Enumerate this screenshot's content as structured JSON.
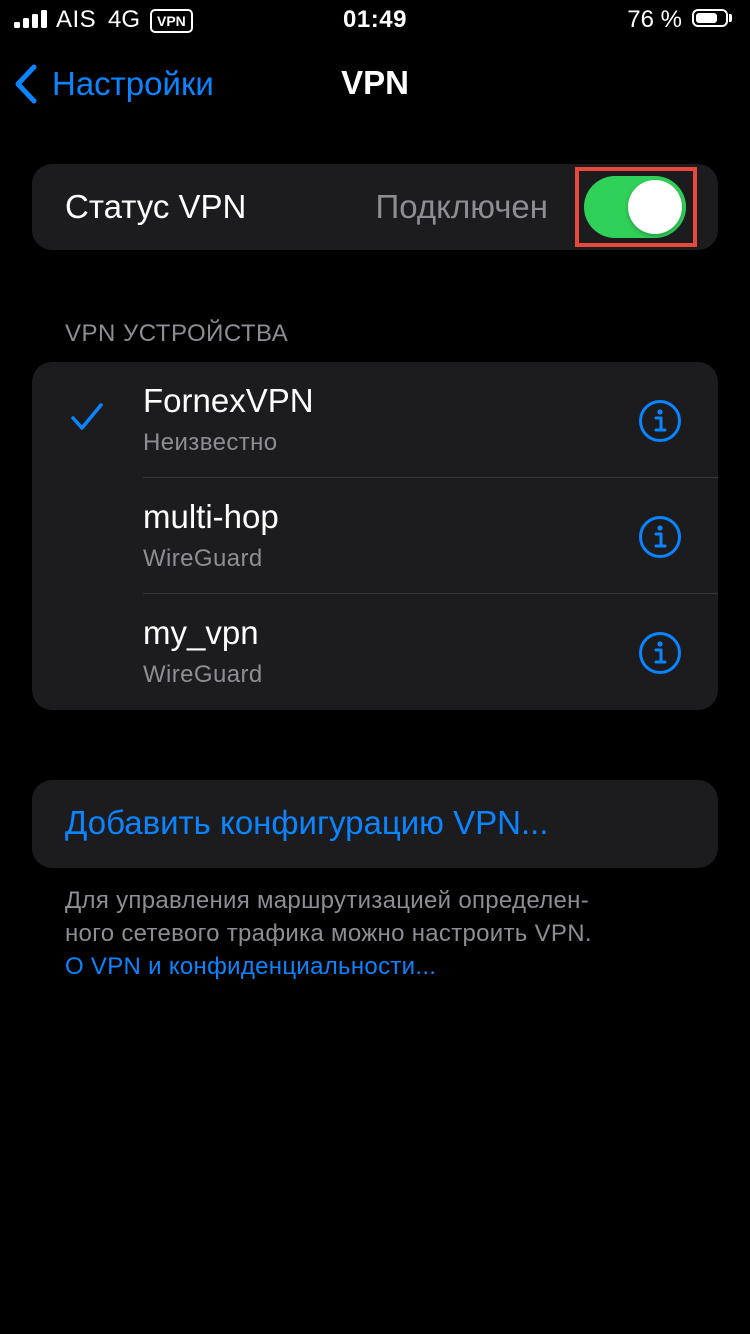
{
  "status_bar": {
    "carrier": "AIS",
    "network": "4G",
    "vpn_badge": "VPN",
    "time": "01:49",
    "battery_percent_label": "76 %",
    "battery_level": 0.76
  },
  "nav": {
    "back_label": "Настройки",
    "title": "VPN"
  },
  "vpn_status": {
    "label": "Статус VPN",
    "value": "Подключен",
    "toggle_on": true,
    "toggle_color": "#30d158"
  },
  "devices": {
    "header": "VPN УСТРОЙСТВА",
    "items": [
      {
        "name": "FornexVPN",
        "type": "Неизвестно",
        "selected": true
      },
      {
        "name": "multi-hop",
        "type": "WireGuard",
        "selected": false
      },
      {
        "name": "my_vpn",
        "type": "WireGuard",
        "selected": false
      }
    ]
  },
  "add_config": {
    "label": "Добавить конфигурацию VPN..."
  },
  "footer": {
    "line1": "Для управления маршрутизацией определен-",
    "line2": "ного сетевого трафика можно настроить VPN.",
    "link": "О VPN и конфиденциальности..."
  },
  "colors": {
    "accent": "#0a84ff",
    "background": "#000000",
    "group_background": "#1c1c1e",
    "secondary_text": "#8d8d93",
    "highlight": "#e8493f"
  },
  "icons": {
    "back": "chevron-left-icon",
    "check": "checkmark-icon",
    "info": "info-circle-icon"
  }
}
